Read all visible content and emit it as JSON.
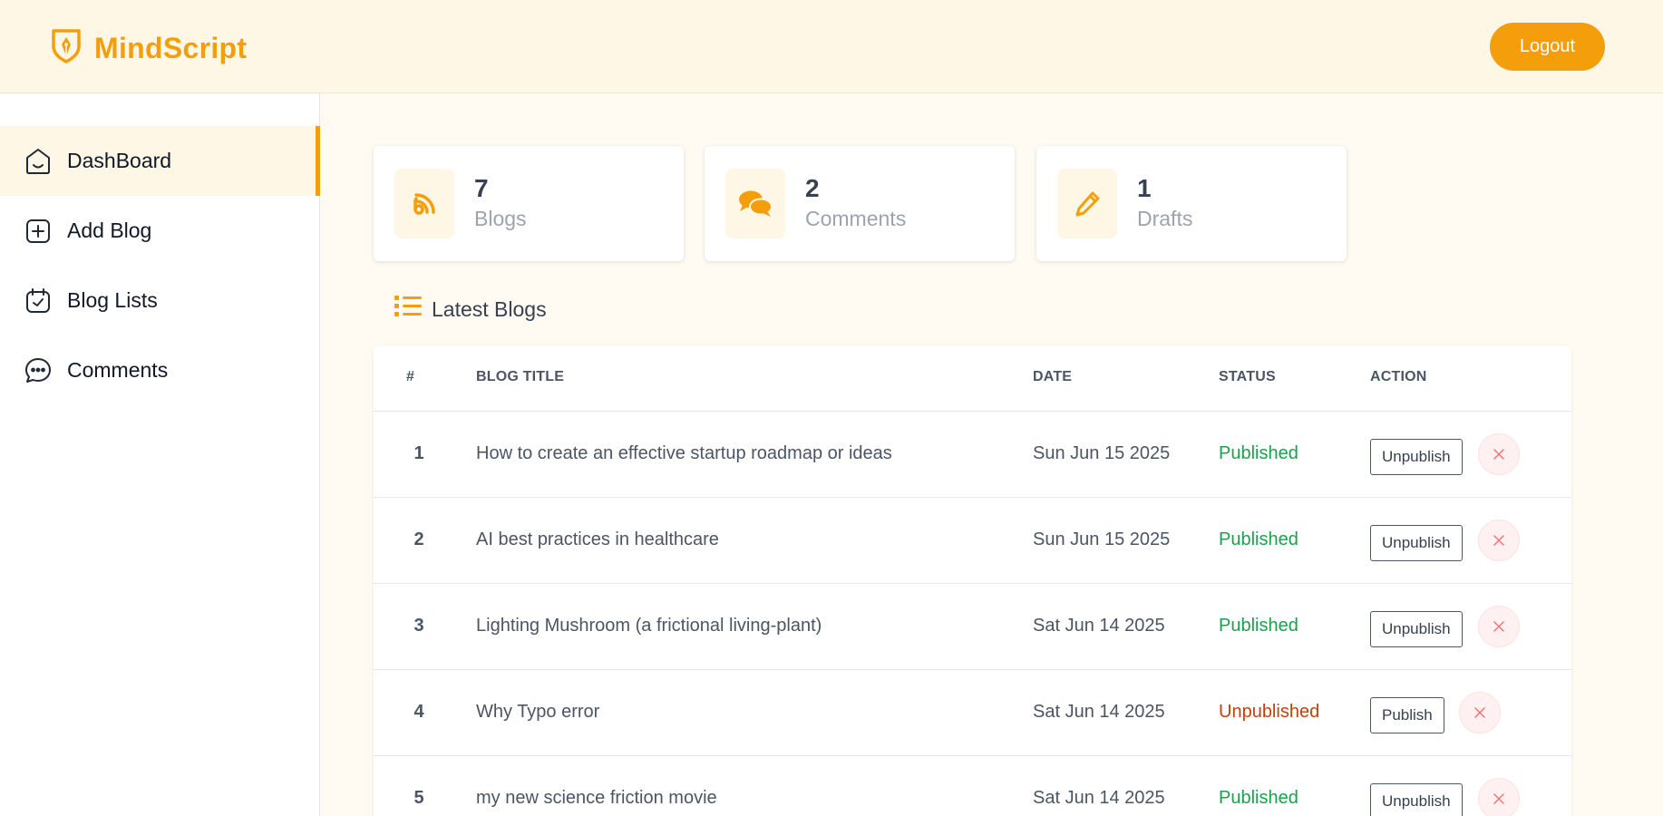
{
  "brand": {
    "name": "MindScript",
    "accent": "#f59e0b",
    "icon": "pen-shield-logo-icon"
  },
  "header": {
    "logout_label": "Logout"
  },
  "sidebar": {
    "items": [
      {
        "label": "DashBoard",
        "icon": "home-icon",
        "active": true
      },
      {
        "label": "Add Blog",
        "icon": "add-square-icon",
        "active": false
      },
      {
        "label": "Blog Lists",
        "icon": "calendar-check-icon",
        "active": false
      },
      {
        "label": "Comments",
        "icon": "chat-bubble-icon",
        "active": false
      }
    ]
  },
  "stats": [
    {
      "value": "7",
      "label": "Blogs",
      "icon": "rss-icon"
    },
    {
      "value": "2",
      "label": "Comments",
      "icon": "comments-icon"
    },
    {
      "value": "1",
      "label": "Drafts",
      "icon": "pencil-icon"
    }
  ],
  "latest": {
    "title": "Latest Blogs",
    "icon": "list-icon",
    "columns": {
      "num": "#",
      "title": "BLOG TITLE",
      "date": "DATE",
      "status": "STATUS",
      "action": "ACTION"
    },
    "rows": [
      {
        "num": "1",
        "title": "How to create an effective startup roadmap or ideas",
        "date": "Sun Jun 15 2025",
        "status": "Published",
        "action": "Unpublish"
      },
      {
        "num": "2",
        "title": "AI best practices in healthcare",
        "date": "Sun Jun 15 2025",
        "status": "Published",
        "action": "Unpublish"
      },
      {
        "num": "3",
        "title": "Lighting Mushroom (a frictional living-plant)",
        "date": "Sat Jun 14 2025",
        "status": "Published",
        "action": "Unpublish"
      },
      {
        "num": "4",
        "title": "Why Typo error",
        "date": "Sat Jun 14 2025",
        "status": "Unpublished",
        "action": "Publish"
      },
      {
        "num": "5",
        "title": "my new science friction movie",
        "date": "Sat Jun 14 2025",
        "status": "Published",
        "action": "Unpublish"
      }
    ]
  }
}
